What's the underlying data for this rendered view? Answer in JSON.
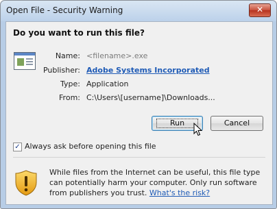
{
  "window": {
    "title": "Open File - Security Warning",
    "close_glyph": "✕"
  },
  "dialog": {
    "question": "Do you want to run this file?",
    "fields": [
      {
        "label": "Name:",
        "value": "<filename>.exe"
      },
      {
        "label": "Publisher:",
        "value": "Adobe Systems Incorporated"
      },
      {
        "label": "Type:",
        "value": "Application"
      },
      {
        "label": "From:",
        "value": "C:\\Users\\[username]\\Downloads..."
      }
    ],
    "buttons": {
      "run": "Run",
      "cancel": "Cancel"
    },
    "checkbox": {
      "label": "Always ask before opening this file",
      "checked": true,
      "check_glyph": "✓"
    },
    "warning": {
      "text": "While files from the Internet can be useful, this file type can potentially harm your computer. Only run software from publishers you trust. ",
      "link": "What's the risk?"
    }
  },
  "icons": {
    "file": "application-file-icon",
    "shield": "security-shield-icon",
    "cursor": "mouse-pointer-icon"
  },
  "colors": {
    "link": "#1f5bb6",
    "close": "#c8503c",
    "title_bg": "#bcd1ea"
  }
}
